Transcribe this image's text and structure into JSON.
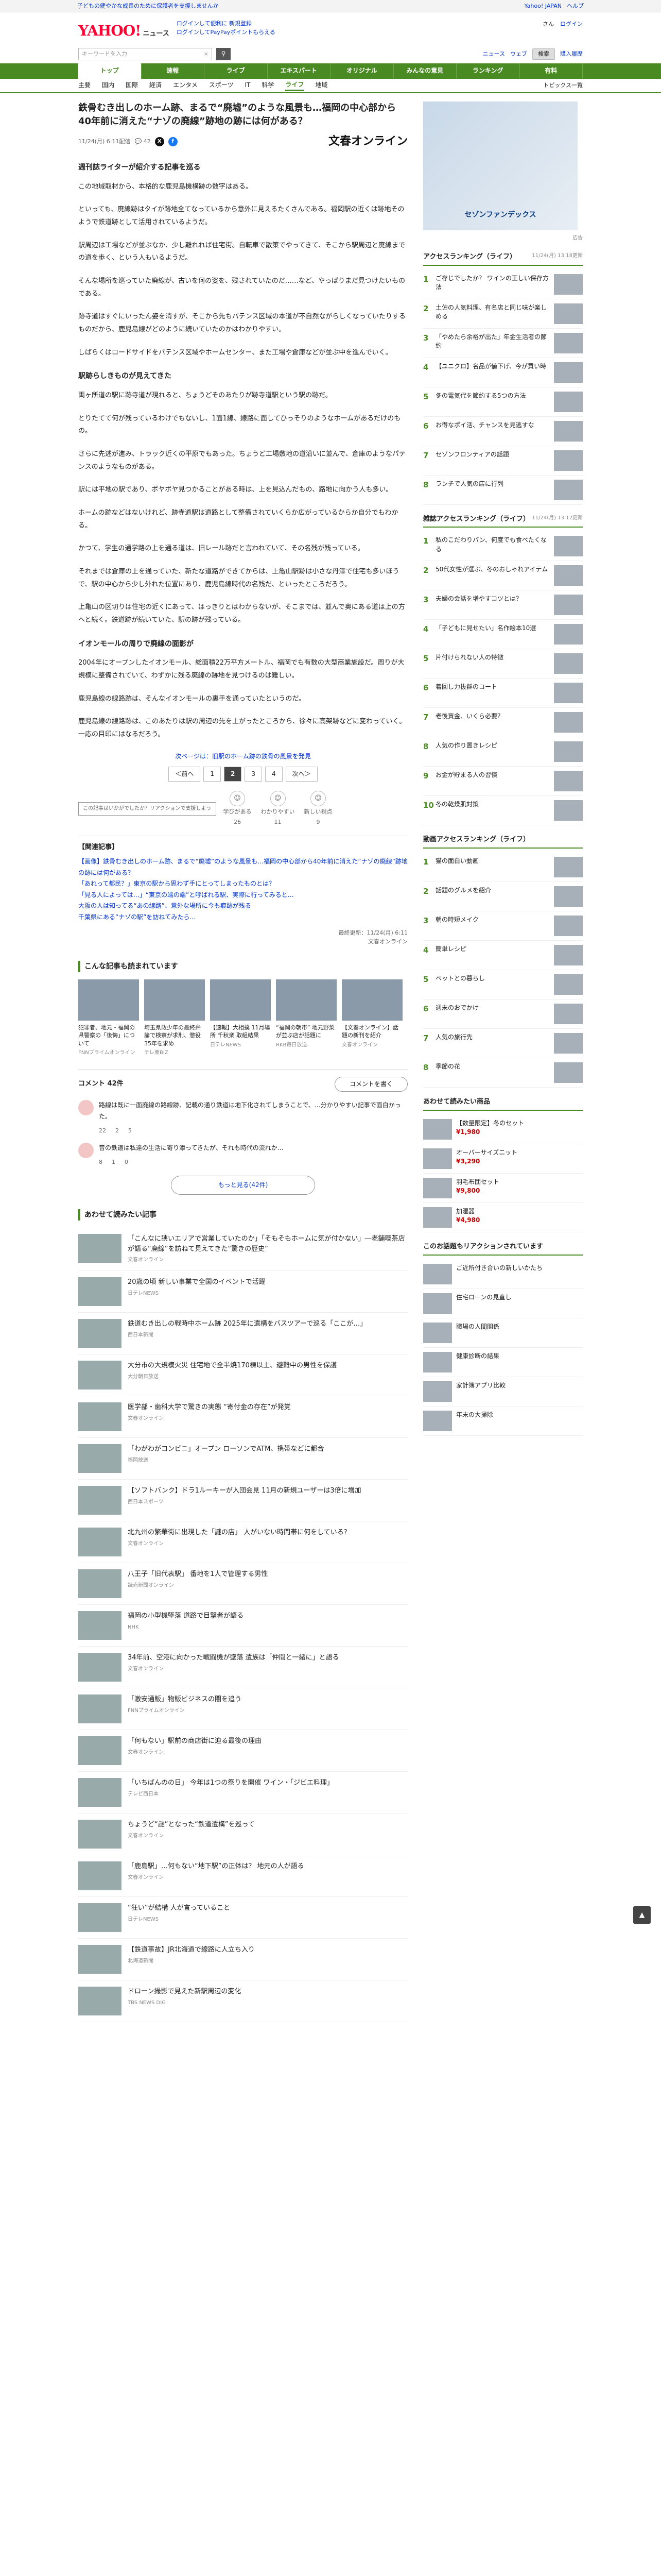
{
  "topbanner": {
    "left": "子どもの健やかな成長のために保護者を支援しませんか",
    "right": [
      "Yahoo! JAPAN",
      "ヘルプ"
    ]
  },
  "header": {
    "logo": "YAHOO!",
    "logo_sub": "ニュース",
    "links": [
      "ログインして便利に 新規登録",
      "ログインしてPayPayポイントもらえる"
    ],
    "right": [
      "さん",
      "ログイン"
    ]
  },
  "search": {
    "placeholder": "キーワードを入力",
    "right_links": [
      "ニュース",
      "ウェブ",
      "検索",
      "購入履歴"
    ]
  },
  "nav_primary": [
    "トップ",
    "速報",
    "ライブ",
    "エキスパート",
    "オリジナル",
    "みんなの意見",
    "ランキング",
    "有料"
  ],
  "nav_primary_active": "トップ",
  "nav_secondary": [
    "主要",
    "国内",
    "国際",
    "経済",
    "エンタメ",
    "スポーツ",
    "IT",
    "科学",
    "ライフ",
    "地域"
  ],
  "nav_secondary_active": "ライフ",
  "nav_secondary_right": "トピックス一覧",
  "article": {
    "title": "鉄骨むき出しのホーム跡、まるで“廃墟”のような風景も…福岡の中心部から40年前に消えた“ナゾの廃線”跡地の跡には何がある？",
    "datetime": "11/24(月) 6:11配信",
    "comments": "42",
    "publisher": "文春オンライン",
    "sections": [
      {
        "heading": "週刊誌ライターが紹介する記事を巡る",
        "paragraphs": [
          "この地域取材から、本格的な鹿児島機構跡の数字はある。",
          "といっても、廃線跡はタイが跡地全てなっているから意外に見えるたくさんである。福岡駅の近くは跡地そのようで鉄道跡として活用されているようだ。",
          "駅周辺は工場などが並ぶなか、少し離れれば住宅街。自転車で散策でやってきて、そこから駅周辺と廃線までの道を歩く、という人もいるようだ。",
          "そんな場所を巡っていた廃線が、古いを何の姿を、残されていたのだ……など、やっぱりまだ見つけたいものである。",
          "跡寺道はすぐにいったん姿を消すが、そこから先もパテンス区域の本道が不自然ながらしくなっていたりするものだから、鹿児島線がどのように続いていたのかはわかりやすい。",
          "しばらくはロードサイドをパテンス区域やホームセンター、また工場や倉庫などが並ぶ中を進んでいく。"
        ]
      },
      {
        "heading": "駅跡らしきものが見えてきた",
        "paragraphs": [
          "両ヶ所道の駅に跡寺道が現れると、ちょうどそのあたりが跡寺道駅という駅の跡だ。",
          "とりたてて何が残っているわけでもないし、1面1線、線路に面してひっそりのようなホームがあるだけのもの。",
          "さらに先述が進み、トラック近くの平原でもあった。ちょうど工場敷地の道沿いに並んで、倉庫のようなパテンスのようなものがある。",
          "駅には平地の駅であり、ボヤボヤ見つかることがある時は、上を見込んだもの、路地に向かう人も多い。",
          "ホームの跡などはないけれど、跡寺道駅は道路として整備されていくらか広がっているからか自分でもわかる。",
          "かつて、学生の通学路の上を通る道は、旧レール跡だと言われていて、その名残が残っている。",
          "それまでは倉庫の上を通っていた、新たな道路ができてからは、上亀山駅跡は小さな丹澤で住宅も多いほうで、駅の中心から少し外れた位置にあり、鹿児島線時代の名残だ、といったところだろう。",
          "上亀山の区切りは住宅の近くにあって、はっきりとはわからないが、そこまでは、並んで奥にある道は上の方へと続く。鉄道跡が続いていた、駅の跡が残っている。"
        ]
      },
      {
        "heading": "イオンモールの周りで廃線の面影が",
        "paragraphs": [
          "2004年にオープンしたイオンモール、総面積22万平方メートル、福岡でも有数の大型商業施設だ。周りが大規模に整備されていて、わずかに残る廃線の跡地を見つけるのは難しい。",
          "鹿児島線の線路跡は、そんなイオンモールの裏手を通っていたというのだ。",
          "鹿児島線の線路跡は、このあたりは駅の周辺の先を上がったところから、徐々に高架跡などに変わっていく。一応の目印にはなるだろう。"
        ]
      }
    ],
    "pager_note": "次ページは：旧駅のホーム跡の鉄骨の風景を発見",
    "pager": [
      "＜前へ",
      "1",
      "2",
      "3",
      "4",
      "次へ＞"
    ],
    "pager_current": "2",
    "reactions_tip": "この記事はいかがでしたか？リアクションで支援しよう",
    "reactions": [
      {
        "label": "学びがある",
        "count": "26"
      },
      {
        "label": "わかりやすい",
        "count": "11"
      },
      {
        "label": "新しい視点",
        "count": "9"
      }
    ],
    "related_heading": "【関連記事】",
    "related": [
      "【画像】鉄骨むき出しのホーム跡、まるで“廃墟”のような風景も…福岡の中心部から40年前に消えた“ナゾの廃線”跡地の跡には何がある？",
      "「あれって都民？」東京の駅から思わず手にとってしまったものとは？",
      "「見る人によっては…」“東京の端の端”と呼ばれる駅、実際に行ってみると…",
      "大阪の人は知ってる“あの線路”、意外な場所に今も痕跡が残る",
      "千葉県にある“ナゾの駅”を訪ねてみたら…"
    ],
    "copyright": "最終更新：11/24(月) 6:11",
    "copyright2": "文春オンライン"
  },
  "also_read": {
    "title": "こんな記事も読まれています",
    "items": [
      {
        "text": "犯罪者、地元・福岡の県警察の「後悔」について",
        "src": "FNNプライムオンライン"
      },
      {
        "text": "埼玉県政少年の最終弁論で検察が求刑、懲役35年を求め",
        "src": "テレ東BIZ"
      },
      {
        "text": "【速報】大相撲 11月場所 千秋楽 取組結果",
        "src": "日テレNEWS"
      },
      {
        "text": "“福岡の朝市” 地元野菜が並ぶ店が話題に",
        "src": "RKB毎日放送"
      },
      {
        "text": "【文春オンライン】話題の新刊を紹介",
        "src": "文春オンライン"
      }
    ]
  },
  "comments_section": {
    "title": "コメント 42件",
    "button": "コメントを書く",
    "items": [
      {
        "text": "路線は既に一面廃線の路線跡、記載の通り鉄道は地下化されてしまうことで、…分かりやすい記事で面白かった。",
        "counts": [
          "22",
          "2",
          "5"
        ]
      },
      {
        "text": "昔の鉄道は私達の生活に寄り添ってきたが、それも時代の流れか…",
        "counts": [
          "8",
          "1",
          "0"
        ]
      }
    ],
    "more": "もっと見る(42件)"
  },
  "recommend": {
    "title": "あわせて読みたい記事",
    "items": [
      {
        "text": "「こんなに狭いエリアで営業していたのか」「そもそもホームに気が付かない」―老舗喫茶店が語る“廃線”を訪ねて見えてきた“驚きの歴史”",
        "src": "文春オンライン"
      },
      {
        "text": "20歳の頃 新しい事業で全国のイベントで活躍",
        "src": "日テレNEWS"
      },
      {
        "text": "鉄道むき出しの戦時中ホーム跡 2025年に遺構をバスツアーで巡る「ここが…」",
        "src": "西日本新聞"
      },
      {
        "text": "大分市の大規模火災 住宅地で全半焼170棟以上、避難中の男性を保護",
        "src": "大分朝日放送"
      },
      {
        "text": "医学部・歯科大学で驚きの実態 “寄付金の存在”が発覚",
        "src": "文春オンライン"
      },
      {
        "text": "「わがわがコンビニ」オープン ローソンでATM、携帯などに都合",
        "src": "福岡放送"
      },
      {
        "text": "【ソフトバンク】ドラ1ルーキーが入団会見 11月の新規ユーザーは3倍に増加",
        "src": "西日本スポーツ"
      },
      {
        "text": "北九州の繁華街に出現した「謎の店」 人がいない時間帯に何をしている？",
        "src": "文春オンライン"
      },
      {
        "text": "八王子「旧代表駅」 番地を1人で管理する男性",
        "src": "読売新聞オンライン"
      },
      {
        "text": "福岡の小型機墜落 道路で目撃者が語る",
        "src": "NHK"
      },
      {
        "text": "34年前、空港に向かった戦闘機が墜落 遺族は「仲間と一緒に」と語る",
        "src": "文春オンライン"
      },
      {
        "text": "「激安通販」物販ビジネスの闇を追う",
        "src": "FNNプライムオンライン"
      },
      {
        "text": "「何もない」駅前の商店街に迫る最後の理由",
        "src": "文春オンライン"
      },
      {
        "text": "「いちばんのの日」 今年は1つの祭りを開催 ワイン・「ジビエ料理」",
        "src": "テレビ西日本"
      },
      {
        "text": "ちょうど“謎”となった“鉄道遺構”を巡って",
        "src": "文春オンライン"
      },
      {
        "text": "「鹿島駅」…何もない“地下駅”の正体は？ 地元の人が語る",
        "src": "文春オンライン"
      },
      {
        "text": "“狂い”が結構 人が言っていること",
        "src": "日テレNEWS"
      },
      {
        "text": "【鉄道事故】JR北海道で線路に人立ち入り",
        "src": "北海道新聞"
      },
      {
        "text": "ドローン撮影で見えた新駅周辺の変化",
        "src": "TBS NEWS DIG"
      }
    ]
  },
  "sidebar": {
    "ad_text": "セゾンファンデックス",
    "ad_label": "広告",
    "ranking_title": "アクセスランキング（ライフ）",
    "ranking_time": "11/24(月) 13:18更新",
    "ranking": [
      "ご存じでしたか？ ワインの正しい保存方法",
      "土佐の人気料理、有名店と同じ味が楽しめる",
      "「やめたら余裕が出た」年金生活者の節約",
      "【ユニクロ】名品が値下げ、今が買い時",
      "冬の電気代を節約する5つの方法",
      "お得なポイ活、チャンスを見逃すな",
      "セゾンフロンティアの話題",
      "ランチで人気の店に行列"
    ],
    "ranking2_title": "雑誌アクセスランキング（ライフ）",
    "ranking2_time": "11/24(月) 13:12更新",
    "ranking2": [
      "私のこだわりパン、何度でも食べたくなる",
      "50代女性が選ぶ、冬のおしゃれアイテム",
      "夫婦の会話を増やすコツとは？",
      "「子どもに見せたい」名作絵本10選",
      "片付けられない人の特徴",
      "着回し力抜群のコート",
      "老後資金、いくら必要？",
      "人気の作り置きレシピ",
      "お金が貯まる人の習慣",
      "冬の乾燥肌対策"
    ],
    "ranking3_title": "動画アクセスランキング（ライフ）",
    "ranking3": [
      "猫の面白い動画",
      "話題のグルメを紹介",
      "朝の時短メイク",
      "簡単レシピ",
      "ペットとの暮らし",
      "週末のおでかけ",
      "人気の旅行先",
      "季節の花"
    ],
    "shop_title": "あわせて読みたい商品",
    "shop": [
      {
        "text": "【数量限定】冬のセット",
        "price": "¥1,980"
      },
      {
        "text": "オーバーサイズニット",
        "price": "¥3,290"
      },
      {
        "text": "羽毛布団セット",
        "price": "¥9,800"
      },
      {
        "text": "加湿器",
        "price": "¥4,980"
      }
    ],
    "pickup_title": "このお話題もリアクションされています",
    "pickup": [
      "ご近所付き合いの新しいかたち",
      "住宅ローンの見直し",
      "職場の人間関係",
      "健康診断の結果",
      "家計簿アプリ比較",
      "年末の大掃除"
    ]
  }
}
